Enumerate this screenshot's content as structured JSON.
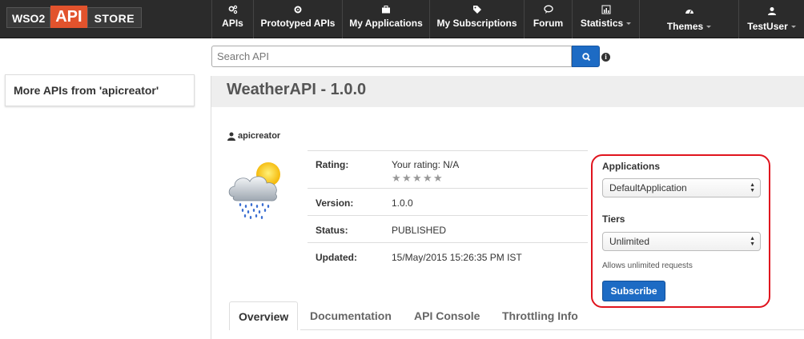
{
  "logo": {
    "part1": "WSO2",
    "part2": "API",
    "part3": "STORE"
  },
  "nav": [
    {
      "label": "APIs",
      "icon": "gears-icon"
    },
    {
      "label": "Prototyped APIs",
      "icon": "gear-icon"
    },
    {
      "label": "My Applications",
      "icon": "briefcase-icon"
    },
    {
      "label": "My Subscriptions",
      "icon": "tags-icon"
    },
    {
      "label": "Forum",
      "icon": "chat-icon"
    },
    {
      "label": "Statistics",
      "icon": "bar-chart-icon"
    },
    {
      "label": "Themes",
      "icon": "dashboard-icon"
    },
    {
      "label": "TestUser",
      "icon": "user-icon"
    }
  ],
  "search": {
    "placeholder": "Search API"
  },
  "sidebar": {
    "title": "More APIs from 'apicreator'"
  },
  "api": {
    "title": "WeatherAPI - 1.0.0",
    "creator": "apicreator",
    "rating_label": "Rating:",
    "rating_value": "Your rating: N/A",
    "stars_total": 5,
    "stars_filled": 0,
    "version_label": "Version:",
    "version_value": "1.0.0",
    "status_label": "Status:",
    "status_value": "PUBLISHED",
    "updated_label": "Updated:",
    "updated_value": "15/May/2015 15:26:35 PM IST"
  },
  "subscribe": {
    "applications_label": "Applications",
    "application_selected": "DefaultApplication",
    "tiers_label": "Tiers",
    "tier_selected": "Unlimited",
    "tier_note": "Allows unlimited requests",
    "button_label": "Subscribe",
    "highlight_color": "#e0141e"
  },
  "tabs": [
    "Overview",
    "Documentation",
    "API Console",
    "Throttling Info"
  ],
  "colors": {
    "navbar": "#2b2b2b",
    "accent": "#1d6bc4",
    "logo_api": "#e2532d"
  }
}
